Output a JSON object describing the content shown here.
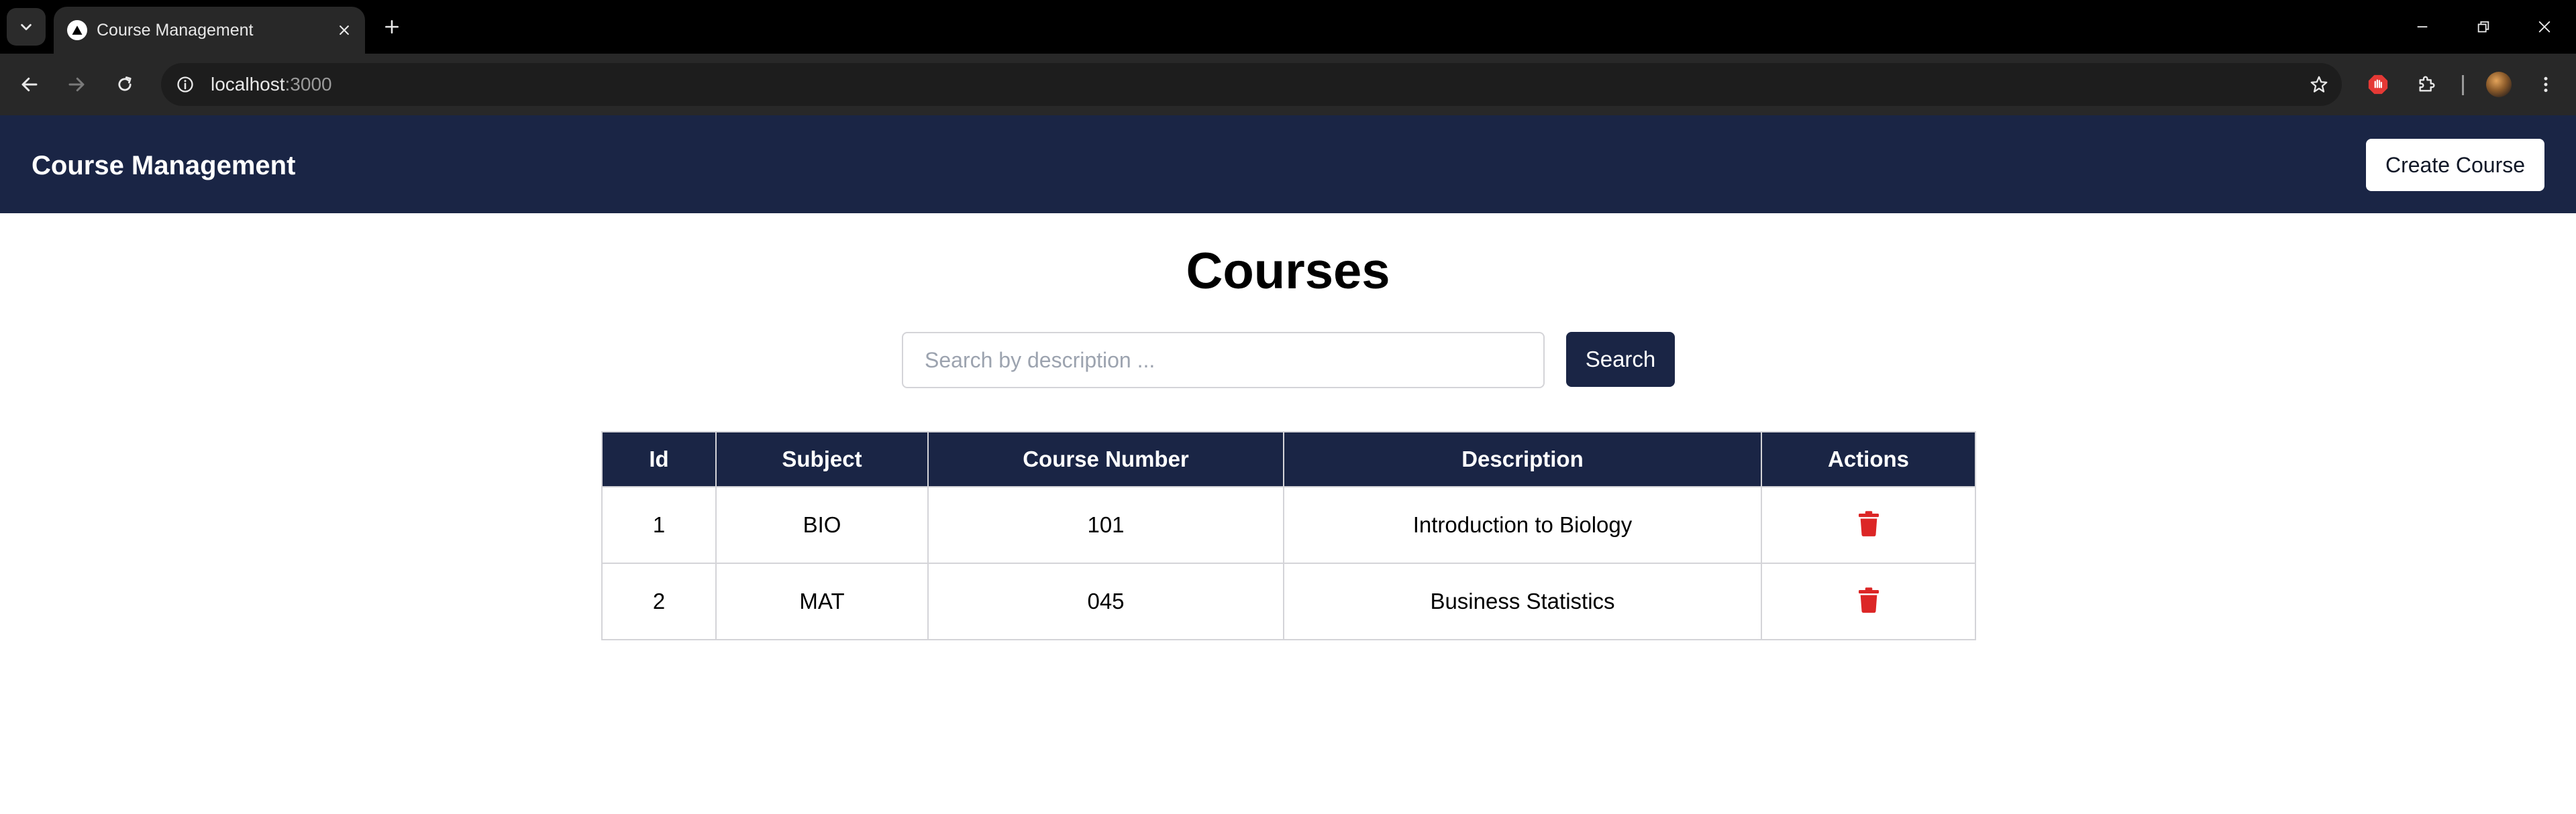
{
  "browser": {
    "tab_title": "Course Management",
    "url_host": "localhost",
    "url_port": ":3000"
  },
  "header": {
    "brand": "Course Management",
    "create_label": "Create Course"
  },
  "main": {
    "title": "Courses",
    "search_placeholder": "Search by description ...",
    "search_label": "Search"
  },
  "table": {
    "columns": [
      "Id",
      "Subject",
      "Course Number",
      "Description",
      "Actions"
    ],
    "rows": [
      {
        "id": "1",
        "subject": "BIO",
        "course_number": "101",
        "description": "Introduction to Biology"
      },
      {
        "id": "2",
        "subject": "MAT",
        "course_number": "045",
        "description": "Business Statistics"
      }
    ]
  },
  "colors": {
    "header_bg": "#1a2545",
    "delete_icon": "#dc2626"
  },
  "icons": {
    "row_action": "trash-icon"
  }
}
